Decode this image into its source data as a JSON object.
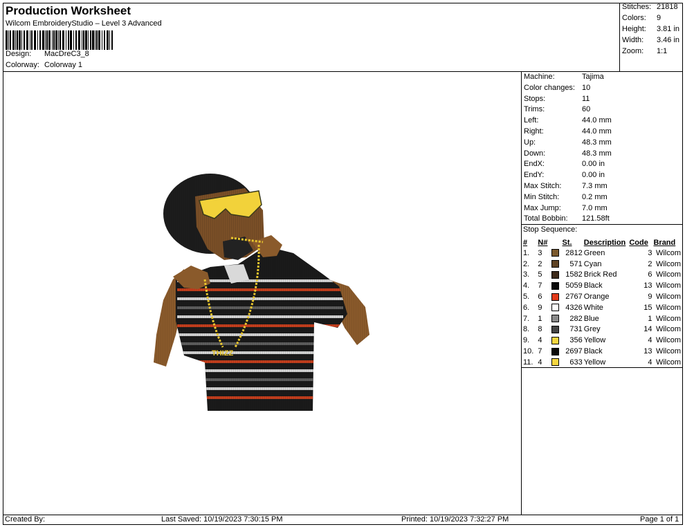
{
  "header": {
    "title": "Production Worksheet",
    "subtitle": "Wilcom EmbroideryStudio – Level 3 Advanced",
    "design_label": "Design:",
    "design_value": "MacDreC3_8",
    "colorway_label": "Colorway:",
    "colorway_value": "Colorway 1"
  },
  "stats": [
    {
      "label": "Stitches:",
      "value": "21818"
    },
    {
      "label": "Colors:",
      "value": "9"
    },
    {
      "label": "Height:",
      "value": "3.81 in"
    },
    {
      "label": "Width:",
      "value": "3.46 in"
    },
    {
      "label": "Zoom:",
      "value": "1:1"
    }
  ],
  "machine": [
    {
      "label": "Machine:",
      "value": "Tajima"
    },
    {
      "label": "Color changes:",
      "value": "10"
    },
    {
      "label": "Stops:",
      "value": "11"
    },
    {
      "label": "Trims:",
      "value": "60"
    },
    {
      "label": "Left:",
      "value": "44.0 mm"
    },
    {
      "label": "Right:",
      "value": "44.0 mm"
    },
    {
      "label": "Up:",
      "value": "48.3 mm"
    },
    {
      "label": "Down:",
      "value": "48.3 mm"
    },
    {
      "label": "EndX:",
      "value": "0.00 in"
    },
    {
      "label": "EndY:",
      "value": "0.00 in"
    },
    {
      "label": "Max Stitch:",
      "value": "7.3 mm"
    },
    {
      "label": "Min Stitch:",
      "value": "0.2 mm"
    },
    {
      "label": "Max Jump:",
      "value": "7.0 mm"
    },
    {
      "label": "Total Bobbin:",
      "value": "121.58ft"
    }
  ],
  "stop_sequence": {
    "title": "Stop Sequence:",
    "headers": [
      "#",
      "N#",
      "St.",
      "Description",
      "Code",
      "Brand"
    ],
    "rows": [
      {
        "idx": "1.",
        "n": "3",
        "color": "#7b5a2e",
        "st": "2812",
        "desc": "Green",
        "code": "3",
        "brand": "Wilcom"
      },
      {
        "idx": "2.",
        "n": "2",
        "color": "#5e4223",
        "st": "571",
        "desc": "Cyan",
        "code": "2",
        "brand": "Wilcom"
      },
      {
        "idx": "3.",
        "n": "5",
        "color": "#3d2a1a",
        "st": "1582",
        "desc": "Brick Red",
        "code": "6",
        "brand": "Wilcom"
      },
      {
        "idx": "4.",
        "n": "7",
        "color": "#0a0a0a",
        "st": "5059",
        "desc": "Black",
        "code": "13",
        "brand": "Wilcom"
      },
      {
        "idx": "5.",
        "n": "6",
        "color": "#e23a1a",
        "st": "2767",
        "desc": "Orange",
        "code": "9",
        "brand": "Wilcom"
      },
      {
        "idx": "6.",
        "n": "9",
        "color": "#ffffff",
        "st": "4326",
        "desc": "White",
        "code": "15",
        "brand": "Wilcom"
      },
      {
        "idx": "7.",
        "n": "1",
        "color": "#8a8a8a",
        "st": "282",
        "desc": "Blue",
        "code": "1",
        "brand": "Wilcom"
      },
      {
        "idx": "8.",
        "n": "8",
        "color": "#444444",
        "st": "731",
        "desc": "Grey",
        "code": "14",
        "brand": "Wilcom"
      },
      {
        "idx": "9.",
        "n": "4",
        "color": "#f5d640",
        "st": "356",
        "desc": "Yellow",
        "code": "4",
        "brand": "Wilcom"
      },
      {
        "idx": "10.",
        "n": "7",
        "color": "#0a0a0a",
        "st": "2697",
        "desc": "Black",
        "code": "13",
        "brand": "Wilcom"
      },
      {
        "idx": "11.",
        "n": "4",
        "color": "#f5d640",
        "st": "633",
        "desc": "Yellow",
        "code": "4",
        "brand": "Wilcom"
      }
    ]
  },
  "footer": {
    "created": "Created By:",
    "saved": "Last Saved: 10/19/2023 7:30:15 PM",
    "printed": "Printed: 10/19/2023 7:32:27 PM",
    "page": "Page 1 of 1"
  },
  "artwork": {
    "chain_text": "THIZZ"
  }
}
